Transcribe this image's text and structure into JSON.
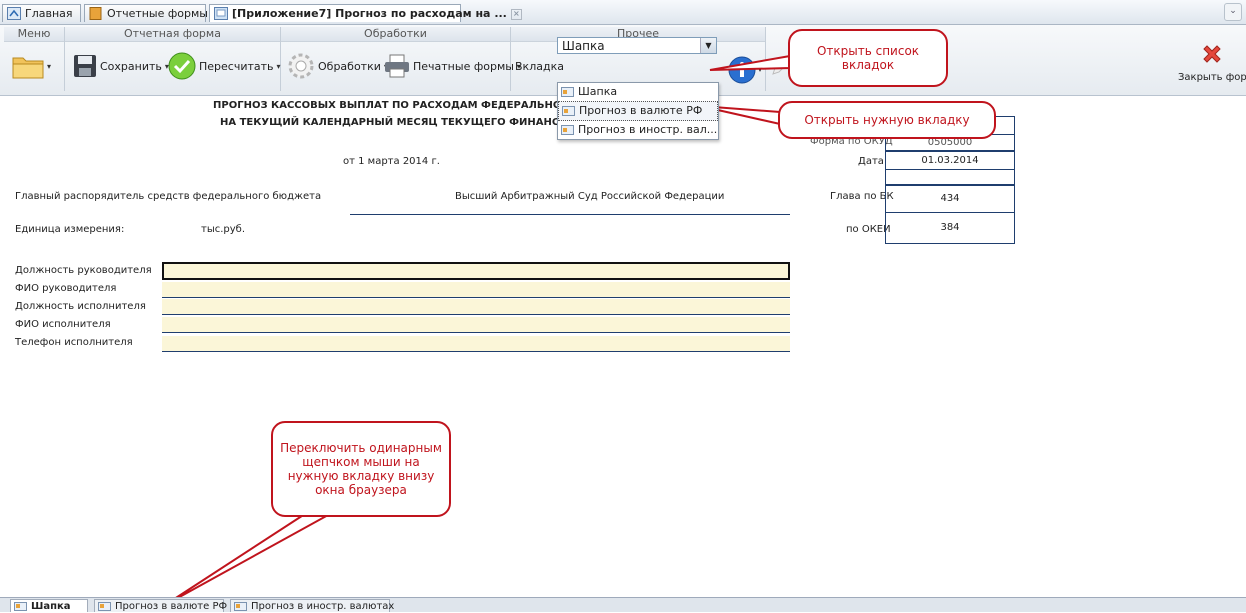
{
  "tabs": [
    {
      "label": "Главная",
      "icon": "home-icon"
    },
    {
      "label": "Отчетные формы",
      "icon": "folder-icon"
    },
    {
      "label": "[Приложение7] Прогноз по расходам на ...",
      "icon": "form-icon"
    }
  ],
  "ribbon": {
    "groups": {
      "menu": "Меню",
      "report_form": "Отчетная форма",
      "processing": "Обработки",
      "other": "Прочее"
    },
    "save_label": "Сохранить",
    "recalc_label": "Пересчитать",
    "processing_label": "Обработки",
    "print_label": "Печатные формы",
    "tab_select_label": "Вкладка",
    "tab_select_value": "Шапка",
    "close_label": "Закрыть форм"
  },
  "dropdown_options": [
    "Шапка",
    "Прогноз в валюте РФ",
    "Прогноз в иностр. вал..."
  ],
  "document": {
    "title1": "ПРОГНОЗ КАССОВЫХ ВЫПЛАТ ПО РАСХОДАМ ФЕДЕРАЛЬНОГО БЮДЖ",
    "title2": "НА ТЕКУЩИЙ КАЛЕНДАРНЫЙ МЕСЯЦ ТЕКУЩЕГО ФИНАНСОВОГО Г",
    "date_text": "от 1 марта 2014 г.",
    "partial_label": "Форма по ОКУД",
    "partial_value": "0505000",
    "date_label": "Дата",
    "date_value": "01.03.2014",
    "gr_label": "Главный распорядитель средств федерального бюджета",
    "gr_value": "Высший Арбитражный Суд Российской Федерации",
    "glava_label": "Глава по БК",
    "glava_value": "434",
    "unit_label": "Единица измерения:",
    "unit_value": "тыс.руб.",
    "okei_label": "по ОКЕИ",
    "okei_value": "384",
    "fields": [
      "Должность руководителя",
      "ФИО руководителя",
      "Должность исполнителя",
      "ФИО исполнителя",
      "Телефон исполнителя"
    ]
  },
  "callouts": {
    "open_list": "Открыть список вкладок",
    "open_tab": "Открыть нужную вкладку",
    "switch_tab": "Переключить одинарным щепчком мыши на нужную вкладку внизу окна браузера"
  },
  "bottom_tabs": [
    "Шапка",
    "Прогноз в валюте РФ",
    "Прогноз в иностр. валютах"
  ],
  "colors": {
    "callout": "#c0141d",
    "field_fill": "#fbf6d8",
    "border_blue": "#1f3e6e"
  }
}
